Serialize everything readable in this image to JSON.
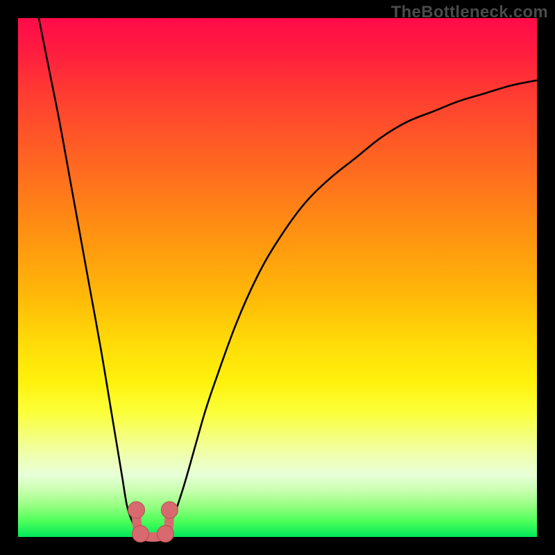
{
  "watermark": "TheBottleneck.com",
  "colors": {
    "page_bg": "#000000",
    "curve": "#000000",
    "marker_fill": "#d86a6f",
    "marker_stroke": "#b44a4f",
    "gradient_top": "#ff0b49",
    "gradient_bottom": "#00e85a"
  },
  "chart_data": {
    "type": "line",
    "title": "",
    "xlabel": "",
    "ylabel": "",
    "xlim": [
      0,
      100
    ],
    "ylim": [
      0,
      100
    ],
    "grid": false,
    "series": [
      {
        "name": "curve-left",
        "x": [
          4,
          6,
          8,
          10,
          12,
          14,
          16,
          18,
          20,
          21,
          22,
          23,
          24
        ],
        "y": [
          100,
          90,
          80,
          69,
          58,
          47,
          36,
          24,
          12,
          6,
          3,
          1,
          0
        ]
      },
      {
        "name": "curve-right",
        "x": [
          28,
          29,
          30,
          32,
          34,
          36,
          38,
          42,
          46,
          50,
          55,
          60,
          65,
          70,
          75,
          80,
          85,
          90,
          95,
          100
        ],
        "y": [
          0,
          2,
          4,
          10,
          17,
          24,
          30,
          41,
          50,
          57,
          64,
          69,
          73,
          77,
          80,
          82,
          84,
          85.5,
          87,
          88
        ]
      },
      {
        "name": "bottom-link",
        "x": [
          24,
          25,
          26,
          27,
          28
        ],
        "y": [
          0,
          0,
          0,
          0,
          0
        ]
      }
    ],
    "markers": [
      {
        "name": "left-shoulder",
        "x": 22.8,
        "y": 5.2
      },
      {
        "name": "left-base",
        "x": 23.6,
        "y": 0.6
      },
      {
        "name": "right-base",
        "x": 28.4,
        "y": 0.6
      },
      {
        "name": "right-shoulder",
        "x": 29.2,
        "y": 5.2
      }
    ],
    "marker_radius": 1.6,
    "bottom_bar_thickness": 1.8
  }
}
